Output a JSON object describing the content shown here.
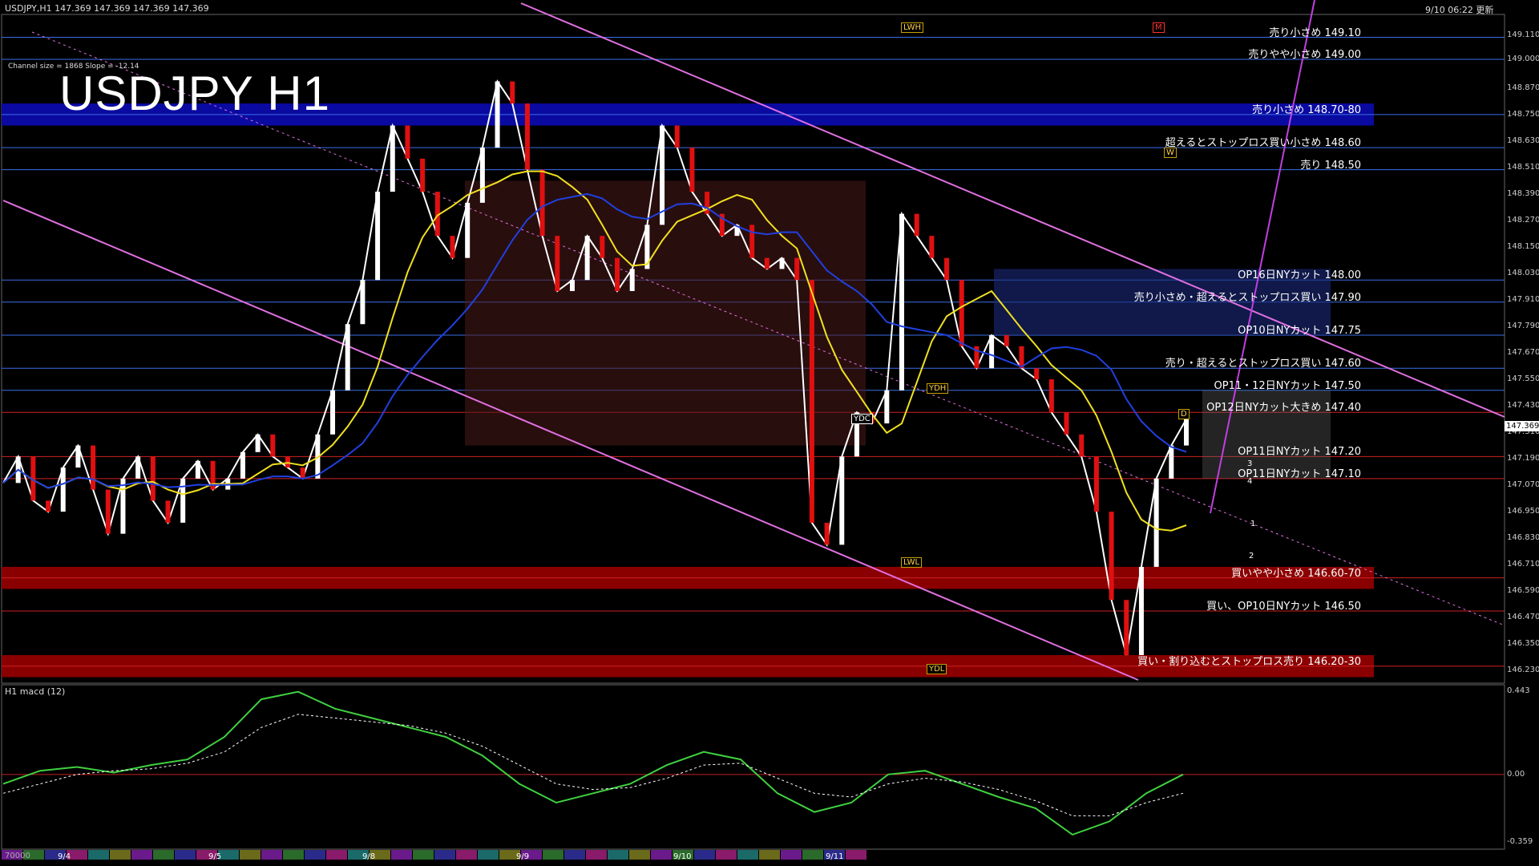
{
  "header": {
    "symbol_line": "USDJPY,H1  147.369 147.369 147.369 147.369",
    "update_time": "9/10 06:22 更新",
    "channel_info": "Channel size = 1868 Slope = -12.14",
    "macd_title": "H1  macd (12)"
  },
  "title": "USDJPY H1",
  "current_price": "147.369",
  "levels": [
    {
      "label": "売り小さめ 149.10",
      "price": 149.1
    },
    {
      "label": "売りやや小さめ 149.00",
      "price": 149.0
    },
    {
      "label": "売り小さめ 148.70-80",
      "price": 148.75
    },
    {
      "label": "超えるとストップロス買い小さめ 148.60",
      "price": 148.6
    },
    {
      "label": "売り 148.50",
      "price": 148.5
    },
    {
      "label": "OP16日NYカット 148.00",
      "price": 148.0
    },
    {
      "label": "売り小さめ・超えるとストップロス買い 147.90",
      "price": 147.9
    },
    {
      "label": "OP10日NYカット 147.75",
      "price": 147.75
    },
    {
      "label": "売り・超えるとストップロス買い 147.60",
      "price": 147.6
    },
    {
      "label": "OP11・12日NYカット 147.50",
      "price": 147.5
    },
    {
      "label": "OP12日NYカット大きめ 147.40",
      "price": 147.4
    },
    {
      "label": "OP11日NYカット 147.20",
      "price": 147.2
    },
    {
      "label": "OP11日NYカット 147.10",
      "price": 147.1
    },
    {
      "label": "買いやや小さめ 146.60-70",
      "price": 146.65
    },
    {
      "label": "買い、OP10日NYカット 146.50",
      "price": 146.5
    },
    {
      "label": "買い・割り込むとストップロス売り 146.20-30",
      "price": 146.25
    }
  ],
  "price_ticks": [
    "149.110",
    "149.000",
    "148.870",
    "148.750",
    "148.630",
    "148.510",
    "148.390",
    "148.270",
    "148.150",
    "148.030",
    "147.910",
    "147.790",
    "147.670",
    "147.550",
    "147.430",
    "147.310",
    "147.190",
    "147.070",
    "146.950",
    "146.830",
    "146.710",
    "146.590",
    "146.470",
    "146.350",
    "146.230"
  ],
  "macd_ticks": [
    "0.443",
    "0.00",
    "-0.359"
  ],
  "volume_tick": "70000",
  "date_ticks": [
    "9/4",
    "9/5",
    "9/8",
    "9/9",
    "9/10",
    "9/11"
  ],
  "markers": {
    "lwh": "LWH",
    "lwl": "LWL",
    "ydh": "YDH",
    "ydl": "YDL",
    "ydc": "YDC",
    "m": "M",
    "w": "W",
    "d": "D",
    "n1": "1",
    "n2": "2",
    "n3": "3",
    "n4": "4"
  },
  "chart_data": {
    "type": "line",
    "title": "USDJPY H1",
    "ylim": [
      146.18,
      149.16
    ],
    "series": [
      {
        "name": "USDJPY,H1",
        "values": [
          147.08,
          147.2,
          147.0,
          146.95,
          147.15,
          147.25,
          147.05,
          146.85,
          147.1,
          147.2,
          147.0,
          146.9,
          147.1,
          147.18,
          147.05,
          147.1,
          147.22,
          147.3,
          147.2,
          147.15,
          147.1,
          147.3,
          147.5,
          147.8,
          148.0,
          148.4,
          148.7,
          148.55,
          148.4,
          148.2,
          148.1,
          148.35,
          148.6,
          148.9,
          148.8,
          148.5,
          148.2,
          147.95,
          148.0,
          148.2,
          148.1,
          147.95,
          148.05,
          148.25,
          148.7,
          148.6,
          148.4,
          148.3,
          148.2,
          148.25,
          148.1,
          148.05,
          148.1,
          148.0,
          146.9,
          146.8,
          147.2,
          147.4,
          147.35,
          147.5,
          148.3,
          148.2,
          148.1,
          148.0,
          147.7,
          147.6,
          147.75,
          147.7,
          147.6,
          147.55,
          147.4,
          147.3,
          147.2,
          146.95,
          146.55,
          146.3,
          146.7,
          147.1,
          147.25,
          147.37
        ]
      }
    ],
    "macd": [
      -0.05,
      0.02,
      0.04,
      0.01,
      0.05,
      0.08,
      0.2,
      0.4,
      0.44,
      0.35,
      0.3,
      0.25,
      0.2,
      0.1,
      -0.05,
      -0.15,
      -0.1,
      -0.05,
      0.05,
      0.12,
      0.08,
      -0.1,
      -0.2,
      -0.15,
      0.0,
      0.02,
      -0.05,
      -0.12,
      -0.18,
      -0.32,
      -0.25,
      -0.1,
      0.0
    ],
    "macd_signal": [
      -0.1,
      -0.05,
      0.0,
      0.02,
      0.03,
      0.06,
      0.12,
      0.25,
      0.32,
      0.3,
      0.28,
      0.26,
      0.22,
      0.15,
      0.05,
      -0.05,
      -0.08,
      -0.07,
      -0.02,
      0.05,
      0.06,
      -0.02,
      -0.1,
      -0.12,
      -0.05,
      -0.02,
      -0.04,
      -0.08,
      -0.14,
      -0.22,
      -0.22,
      -0.15,
      -0.1
    ]
  }
}
